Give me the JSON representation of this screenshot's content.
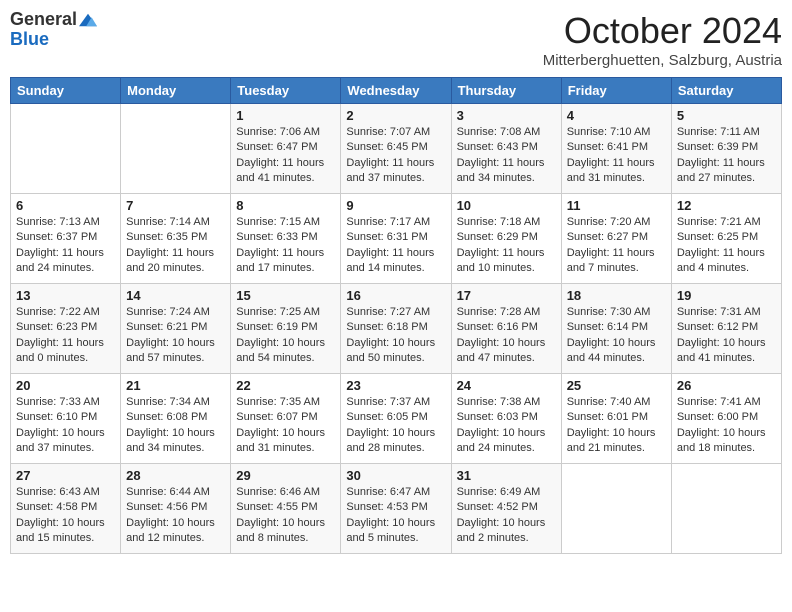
{
  "header": {
    "logo_general": "General",
    "logo_blue": "Blue",
    "month": "October 2024",
    "location": "Mitterberghuetten, Salzburg, Austria"
  },
  "weekdays": [
    "Sunday",
    "Monday",
    "Tuesday",
    "Wednesday",
    "Thursday",
    "Friday",
    "Saturday"
  ],
  "weeks": [
    [
      {
        "day": "",
        "info": ""
      },
      {
        "day": "",
        "info": ""
      },
      {
        "day": "1",
        "info": "Sunrise: 7:06 AM\nSunset: 6:47 PM\nDaylight: 11 hours and 41 minutes."
      },
      {
        "day": "2",
        "info": "Sunrise: 7:07 AM\nSunset: 6:45 PM\nDaylight: 11 hours and 37 minutes."
      },
      {
        "day": "3",
        "info": "Sunrise: 7:08 AM\nSunset: 6:43 PM\nDaylight: 11 hours and 34 minutes."
      },
      {
        "day": "4",
        "info": "Sunrise: 7:10 AM\nSunset: 6:41 PM\nDaylight: 11 hours and 31 minutes."
      },
      {
        "day": "5",
        "info": "Sunrise: 7:11 AM\nSunset: 6:39 PM\nDaylight: 11 hours and 27 minutes."
      }
    ],
    [
      {
        "day": "6",
        "info": "Sunrise: 7:13 AM\nSunset: 6:37 PM\nDaylight: 11 hours and 24 minutes."
      },
      {
        "day": "7",
        "info": "Sunrise: 7:14 AM\nSunset: 6:35 PM\nDaylight: 11 hours and 20 minutes."
      },
      {
        "day": "8",
        "info": "Sunrise: 7:15 AM\nSunset: 6:33 PM\nDaylight: 11 hours and 17 minutes."
      },
      {
        "day": "9",
        "info": "Sunrise: 7:17 AM\nSunset: 6:31 PM\nDaylight: 11 hours and 14 minutes."
      },
      {
        "day": "10",
        "info": "Sunrise: 7:18 AM\nSunset: 6:29 PM\nDaylight: 11 hours and 10 minutes."
      },
      {
        "day": "11",
        "info": "Sunrise: 7:20 AM\nSunset: 6:27 PM\nDaylight: 11 hours and 7 minutes."
      },
      {
        "day": "12",
        "info": "Sunrise: 7:21 AM\nSunset: 6:25 PM\nDaylight: 11 hours and 4 minutes."
      }
    ],
    [
      {
        "day": "13",
        "info": "Sunrise: 7:22 AM\nSunset: 6:23 PM\nDaylight: 11 hours and 0 minutes."
      },
      {
        "day": "14",
        "info": "Sunrise: 7:24 AM\nSunset: 6:21 PM\nDaylight: 10 hours and 57 minutes."
      },
      {
        "day": "15",
        "info": "Sunrise: 7:25 AM\nSunset: 6:19 PM\nDaylight: 10 hours and 54 minutes."
      },
      {
        "day": "16",
        "info": "Sunrise: 7:27 AM\nSunset: 6:18 PM\nDaylight: 10 hours and 50 minutes."
      },
      {
        "day": "17",
        "info": "Sunrise: 7:28 AM\nSunset: 6:16 PM\nDaylight: 10 hours and 47 minutes."
      },
      {
        "day": "18",
        "info": "Sunrise: 7:30 AM\nSunset: 6:14 PM\nDaylight: 10 hours and 44 minutes."
      },
      {
        "day": "19",
        "info": "Sunrise: 7:31 AM\nSunset: 6:12 PM\nDaylight: 10 hours and 41 minutes."
      }
    ],
    [
      {
        "day": "20",
        "info": "Sunrise: 7:33 AM\nSunset: 6:10 PM\nDaylight: 10 hours and 37 minutes."
      },
      {
        "day": "21",
        "info": "Sunrise: 7:34 AM\nSunset: 6:08 PM\nDaylight: 10 hours and 34 minutes."
      },
      {
        "day": "22",
        "info": "Sunrise: 7:35 AM\nSunset: 6:07 PM\nDaylight: 10 hours and 31 minutes."
      },
      {
        "day": "23",
        "info": "Sunrise: 7:37 AM\nSunset: 6:05 PM\nDaylight: 10 hours and 28 minutes."
      },
      {
        "day": "24",
        "info": "Sunrise: 7:38 AM\nSunset: 6:03 PM\nDaylight: 10 hours and 24 minutes."
      },
      {
        "day": "25",
        "info": "Sunrise: 7:40 AM\nSunset: 6:01 PM\nDaylight: 10 hours and 21 minutes."
      },
      {
        "day": "26",
        "info": "Sunrise: 7:41 AM\nSunset: 6:00 PM\nDaylight: 10 hours and 18 minutes."
      }
    ],
    [
      {
        "day": "27",
        "info": "Sunrise: 6:43 AM\nSunset: 4:58 PM\nDaylight: 10 hours and 15 minutes."
      },
      {
        "day": "28",
        "info": "Sunrise: 6:44 AM\nSunset: 4:56 PM\nDaylight: 10 hours and 12 minutes."
      },
      {
        "day": "29",
        "info": "Sunrise: 6:46 AM\nSunset: 4:55 PM\nDaylight: 10 hours and 8 minutes."
      },
      {
        "day": "30",
        "info": "Sunrise: 6:47 AM\nSunset: 4:53 PM\nDaylight: 10 hours and 5 minutes."
      },
      {
        "day": "31",
        "info": "Sunrise: 6:49 AM\nSunset: 4:52 PM\nDaylight: 10 hours and 2 minutes."
      },
      {
        "day": "",
        "info": ""
      },
      {
        "day": "",
        "info": ""
      }
    ]
  ]
}
